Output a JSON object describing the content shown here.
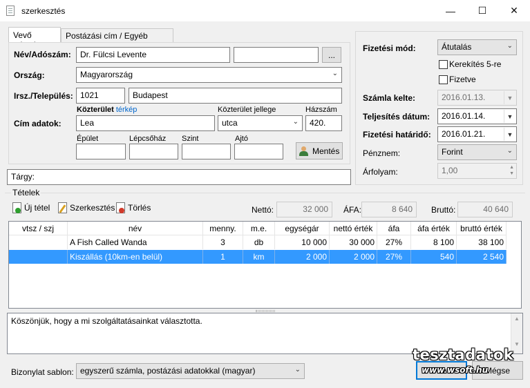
{
  "window": {
    "title": "szerkesztés",
    "min": "—",
    "max": "☐",
    "close": "✕"
  },
  "tabs": [
    "Vevő adatok",
    "Postázási cím / Egyéb adatok"
  ],
  "customer": {
    "name_label": "Név/Adószám:",
    "name_value": "Dr. Fülcsi Levente",
    "tax_value": "",
    "browse_label": "...",
    "country_label": "Ország:",
    "country_value": "Magyarország",
    "zip_label": "Irsz./Település:",
    "zip_value": "1021",
    "city_value": "Budapest",
    "address_label": "Cím adatok:",
    "street_label": "Közterület",
    "map_link": "térkép",
    "street_type_label": "Közterület jellege",
    "house_label": "Házszám",
    "street_value": "Lea",
    "street_type_value": "utca",
    "house_value": "420.",
    "building_label": "Épület",
    "stair_label": "Lépcsőház",
    "level_label": "Szint",
    "door_label": "Ajtó",
    "building_value": "",
    "stair_value": "",
    "level_value": "",
    "door_value": "",
    "save_label": "Mentés"
  },
  "subject": {
    "label": "Tárgy:",
    "value": ""
  },
  "payment": {
    "method_label": "Fizetési mód:",
    "method_value": "Átutalás",
    "round_label": "Kerekítés 5-re",
    "paid_label": "Fizetve",
    "issue_label": "Számla kelte:",
    "issue_value": "2016.01.13.",
    "fulfil_label": "Teljesítés dátum:",
    "fulfil_value": "2016.01.14.",
    "due_label": "Fizetési határidő:",
    "due_value": "2016.01.21.",
    "currency_label": "Pénznem:",
    "currency_value": "Forint",
    "rate_label": "Árfolyam:",
    "rate_value": "1,00"
  },
  "items": {
    "group_label": "Tételek",
    "new_label": "Új tétel",
    "edit_label": "Szerkesztés",
    "delete_label": "Törlés",
    "net_label": "Nettó:",
    "net_value": "32 000",
    "vat_label": "ÁFA:",
    "vat_value": "8 640",
    "gross_label": "Bruttó:",
    "gross_value": "40 640",
    "columns": [
      "vtsz / szj",
      "név",
      "menny.",
      "m.e.",
      "egységár",
      "nettó érték",
      "áfa",
      "áfa érték",
      "bruttó érték"
    ],
    "rows": [
      [
        "",
        "A Fish Called Wanda",
        "3",
        "db",
        "10 000",
        "30 000",
        "27%",
        "8 100",
        "38 100"
      ],
      [
        "",
        "Kiszállás (10km-en belül)",
        "1",
        "km",
        "2 000",
        "2 000",
        "27%",
        "540",
        "2 540"
      ]
    ]
  },
  "note": "Köszönjük, hogy a mi szolgáltatásainkat választotta.",
  "footer": {
    "template_label": "Bizonylat sablon:",
    "template_value": "egyszerű számla, postázási adatokkal (magyar)",
    "ok_label": "Ok",
    "cancel_label": "Mégse"
  },
  "watermark": {
    "line1": "tesztadatok",
    "line2": "www.wsoft.hu"
  },
  "colors": {
    "selection": "#3399ff",
    "link": "#0066cc"
  }
}
